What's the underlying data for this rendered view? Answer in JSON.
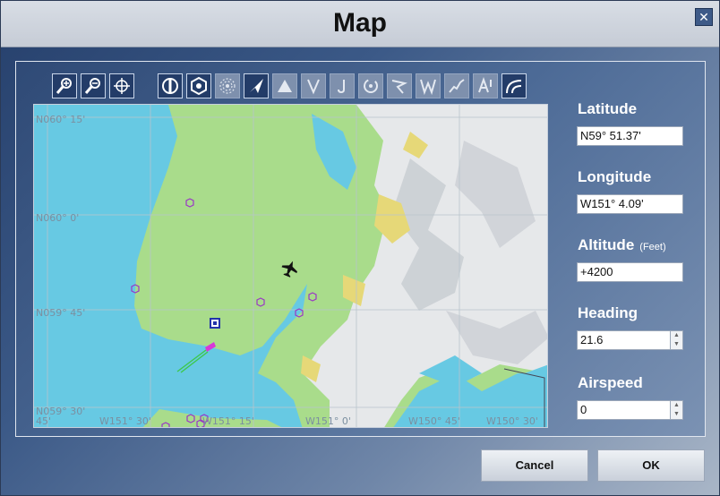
{
  "window": {
    "title": "Map",
    "close_glyph": "✕"
  },
  "toolbar": {
    "tools": [
      {
        "name": "zoom-in-icon",
        "state": "on"
      },
      {
        "name": "zoom-out-icon",
        "state": "on"
      },
      {
        "name": "center-crosshair-icon",
        "state": "on"
      },
      {
        "name": "airport-filter-icon",
        "state": "on"
      },
      {
        "name": "vor-filter-icon",
        "state": "on"
      },
      {
        "name": "ndb-filter-icon",
        "state": "off"
      },
      {
        "name": "aircraft-track-icon",
        "state": "on"
      },
      {
        "name": "triangle-waypoint-icon",
        "state": "off"
      },
      {
        "name": "victor-airway-icon",
        "state": "off"
      },
      {
        "name": "jet-airway-icon",
        "state": "off"
      },
      {
        "name": "reset-rotation-icon",
        "state": "off"
      },
      {
        "name": "route-icon",
        "state": "off"
      },
      {
        "name": "wind-icon",
        "state": "off"
      },
      {
        "name": "terrain-profile-icon",
        "state": "off"
      },
      {
        "name": "altitude-icon",
        "state": "off"
      },
      {
        "name": "terrain-shading-icon",
        "state": "on"
      }
    ]
  },
  "map": {
    "labels": {
      "lat_60_15": "N060° 15'",
      "lat_60_00": "N060°  0'",
      "lat_59_45": "N059° 45'",
      "lat_59_30": "N059° 30'",
      "lon_151_45": "45'",
      "lon_151_30": "W151° 30'",
      "lon_151_15": "W151° 15'",
      "lon_151_00": "W151°  0'",
      "lon_150_45": "W150° 45'",
      "lon_150_30": "W150° 30'"
    }
  },
  "fields": {
    "latitude": {
      "label": "Latitude",
      "value": "N59° 51.37'"
    },
    "longitude": {
      "label": "Longitude",
      "value": "W151° 4.09'"
    },
    "altitude": {
      "label": "Altitude",
      "unit": "(Feet)",
      "value": "+4200"
    },
    "heading": {
      "label": "Heading",
      "value": "21.6"
    },
    "airspeed": {
      "label": "Airspeed",
      "value": "0"
    }
  },
  "buttons": {
    "cancel": "Cancel",
    "ok": "OK"
  },
  "colors": {
    "water": "#67c9e3",
    "land": "#a9dc8b",
    "snow": "#e6e8ea",
    "accent": "#2b4573"
  }
}
